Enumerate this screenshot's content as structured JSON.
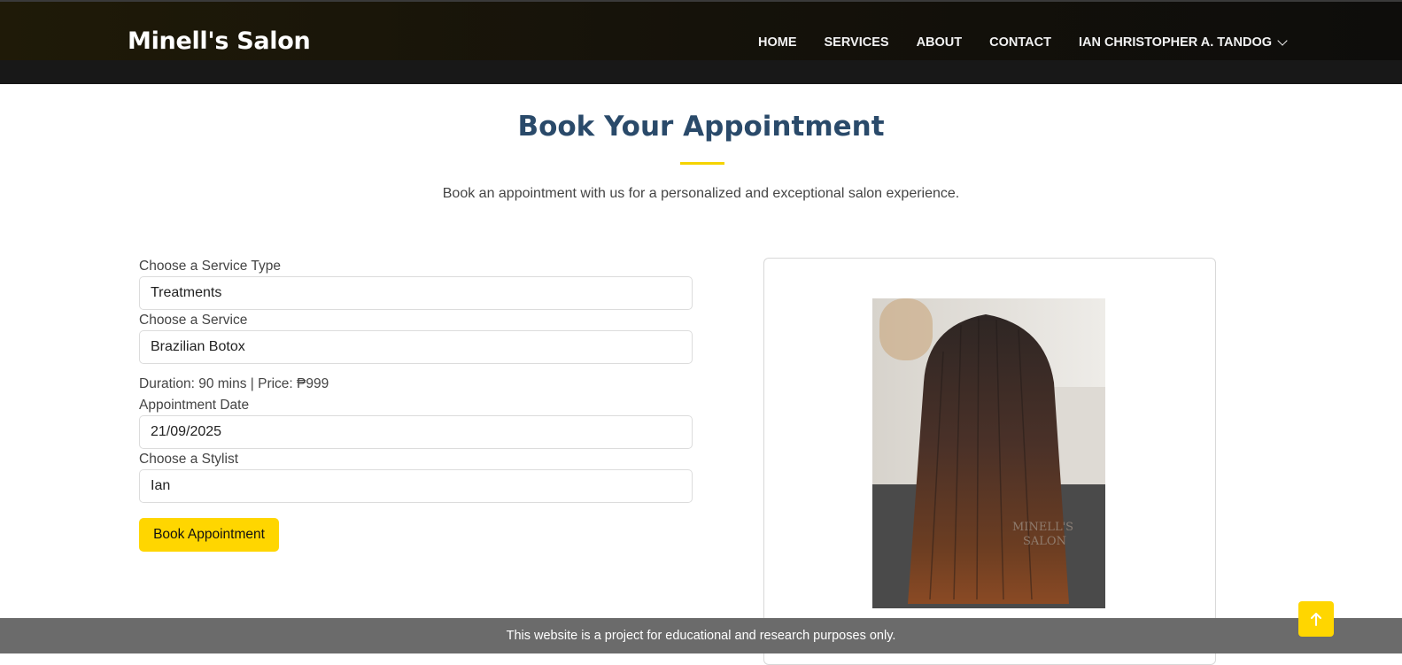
{
  "header": {
    "brand": "Minell's Salon",
    "nav": {
      "home": "HOME",
      "services": "SERVICES",
      "about": "ABOUT",
      "contact": "CONTACT",
      "user": "IAN CHRISTOPHER A. TANDOG"
    }
  },
  "main": {
    "title": "Book Your Appointment",
    "subtitle": "Book an appointment with us for a personalized and exceptional salon experience."
  },
  "form": {
    "service_type_label": "Choose a Service Type",
    "service_type_value": "Treatments",
    "service_label": "Choose a Service",
    "service_value": "Brazilian Botox",
    "info": "Duration: 90 mins | Price: ₱999",
    "date_label": "Appointment Date",
    "date_value": "21/09/2025",
    "stylist_label": "Choose a Stylist",
    "stylist_value": "Ian",
    "submit_label": "Book Appointment"
  },
  "footer": {
    "notice": "This website is a project for educational and research purposes only."
  },
  "colors": {
    "accent": "#ffd600",
    "title": "#2a4a6a",
    "header_bg": "#181818",
    "footer_bg": "#6b6b6b"
  },
  "icons": {
    "dropdown": "chevron-down-icon",
    "back_to_top": "arrow-up-icon"
  }
}
